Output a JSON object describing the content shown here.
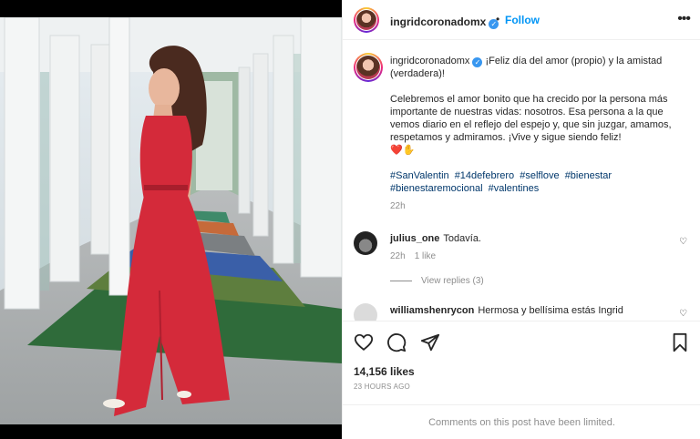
{
  "header": {
    "username": "ingridcoronadomx",
    "dot": "•",
    "follow_label": "Follow",
    "more_icon": "more-horizontal-icon"
  },
  "caption": {
    "username": "ingridcoronadomx",
    "line1": "¡Feliz día del amor (propio) y la amistad (verdadera)!",
    "paragraph": "Celebremos el amor bonito que ha crecido por la persona más importante de nuestras vidas: nosotros. Esa persona a la que vemos diario en el reflejo del espejo y, que sin juzgar, amamos, respetamos y admiramos. ¡Vive y sigue siendo feliz!",
    "emojis": "❤️✋",
    "hashtags": [
      "#SanValentin",
      "#14defebrero",
      "#selflove",
      "#bienestar",
      "#bienestaremocional",
      "#valentines"
    ],
    "time": "22h"
  },
  "comments": [
    {
      "username": "julius_one",
      "text": "Todavía.",
      "time": "22h",
      "likes": "1 like",
      "view_replies": "View replies (3)"
    },
    {
      "username": "williamshenrycon",
      "text": "Hermosa y bellísima estás Ingrid"
    }
  ],
  "actions": {
    "icons": [
      "heart-icon",
      "comment-icon",
      "share-icon",
      "bookmark-icon"
    ],
    "likes": "14,156 likes",
    "timestamp": "23 HOURS AGO"
  },
  "footer": {
    "limited_text": "Comments on this post have been limited."
  },
  "colors": {
    "link_blue": "#0095f6",
    "hashtag_blue": "#00376b",
    "muted": "#8e8e8e",
    "dress_red": "#d42a3a"
  }
}
